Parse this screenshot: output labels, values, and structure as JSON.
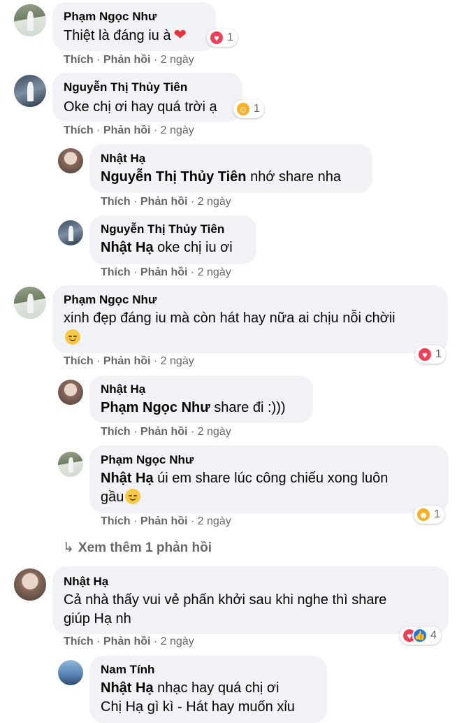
{
  "comments": [
    {
      "name": "Phạm Ngọc Như",
      "text": "Thiệt là đáng iu à",
      "reaction_count": "1"
    },
    {
      "name": "Nguyễn Thị Thủy Tiên",
      "text": "Oke chị ơi hay quá trời ạ",
      "reaction_count": "1"
    },
    {
      "name": "Nhật Hạ",
      "mention": "Nguyễn Thị Thủy Tiên",
      "text": " nhớ share nha"
    },
    {
      "name": "Nguyễn Thị Thủy Tiên",
      "mention": "Nhật Hạ",
      "text": " oke chị iu ơi"
    },
    {
      "name": "Phạm Ngọc Như",
      "text_line1": "xinh đẹp đáng iu mà còn hát hay nữa ai chịu nỗi chờii",
      "reaction_count": "1"
    },
    {
      "name": "Nhật Hạ",
      "mention": "Phạm Ngọc Như",
      "text": " share đi :)))"
    },
    {
      "name": "Phạm Ngọc Như",
      "mention": "Nhật Hạ",
      "text_line1": " úi em share lúc công chiếu xong luôn",
      "text_line2": "gầu",
      "reaction_count": "1"
    },
    {
      "name": "Nhật Hạ",
      "text_line1": "Cả nhà thấy vui vẻ phấn khởi sau khi nghe thì share",
      "text_line2": "giúp Hạ nh",
      "reaction_count": "4"
    },
    {
      "name": "Nam Tính",
      "mention": "Nhật Hạ",
      "text": " nhạc hay quá chị ơi",
      "text_line2": "Chị Hạ gì kì - Hát hay muốn xỉu"
    }
  ],
  "actions": {
    "like": "Thích",
    "reply": "Phản hồi",
    "sep": " · ",
    "time": "2 ngày"
  },
  "see_more": "Xem thêm 1 phản hồi",
  "colors": {
    "bubble": "#f0f2f5",
    "meta": "#65676b",
    "love": "#f33e58",
    "like": "#1877f2"
  }
}
